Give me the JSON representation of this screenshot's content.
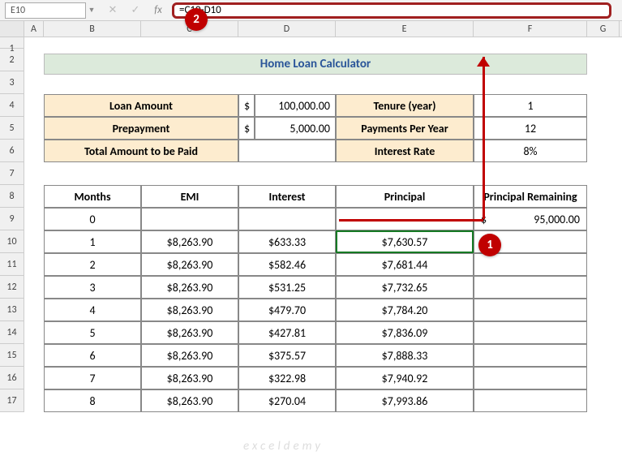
{
  "name_box": "E10",
  "formula": "=C10-D10",
  "columns": [
    "A",
    "B",
    "C",
    "D",
    "E",
    "F",
    "G"
  ],
  "row_nums": [
    1,
    2,
    3,
    4,
    5,
    6,
    7,
    8,
    9,
    10,
    11,
    12,
    13,
    14,
    15,
    16,
    17
  ],
  "title": "Home Loan Calculator",
  "info": {
    "loan_amount_label": "Loan Amount",
    "loan_amount_cur": "$",
    "loan_amount_val": "100,000.00",
    "tenure_label": "Tenure (year)",
    "tenure_val": "1",
    "prepay_label": "Prepayment",
    "prepay_cur": "$",
    "prepay_val": "5,000.00",
    "ppy_label": "Payments Per Year",
    "ppy_val": "12",
    "total_label": "Total Amount to be Paid",
    "rate_label": "Interest Rate",
    "rate_val": "8%"
  },
  "table": {
    "headers": {
      "months": "Months",
      "emi": "EMI",
      "interest": "Interest",
      "principal": "Principal",
      "remaining": "Principal Remaining"
    },
    "row0": {
      "months": "0",
      "remaining_cur": "$",
      "remaining_val": "95,000.00"
    },
    "rows": [
      {
        "months": "1",
        "emi": "$8,263.90",
        "interest": "$633.33",
        "principal": "$7,630.57"
      },
      {
        "months": "2",
        "emi": "$8,263.90",
        "interest": "$582.46",
        "principal": "$7,681.44"
      },
      {
        "months": "3",
        "emi": "$8,263.90",
        "interest": "$531.25",
        "principal": "$7,732.65"
      },
      {
        "months": "4",
        "emi": "$8,263.90",
        "interest": "$479.70",
        "principal": "$7,784.20"
      },
      {
        "months": "5",
        "emi": "$8,263.90",
        "interest": "$427.81",
        "principal": "$7,836.09"
      },
      {
        "months": "6",
        "emi": "$8,263.90",
        "interest": "$375.57",
        "principal": "$7,888.33"
      },
      {
        "months": "7",
        "emi": "$8,263.90",
        "interest": "$322.98",
        "principal": "$7,940.92"
      },
      {
        "months": "8",
        "emi": "$8,263.90",
        "interest": "$270.04",
        "principal": "$7,993.86"
      }
    ]
  },
  "annot": {
    "one": "1",
    "two": "2"
  },
  "watermark": "exceldemy"
}
